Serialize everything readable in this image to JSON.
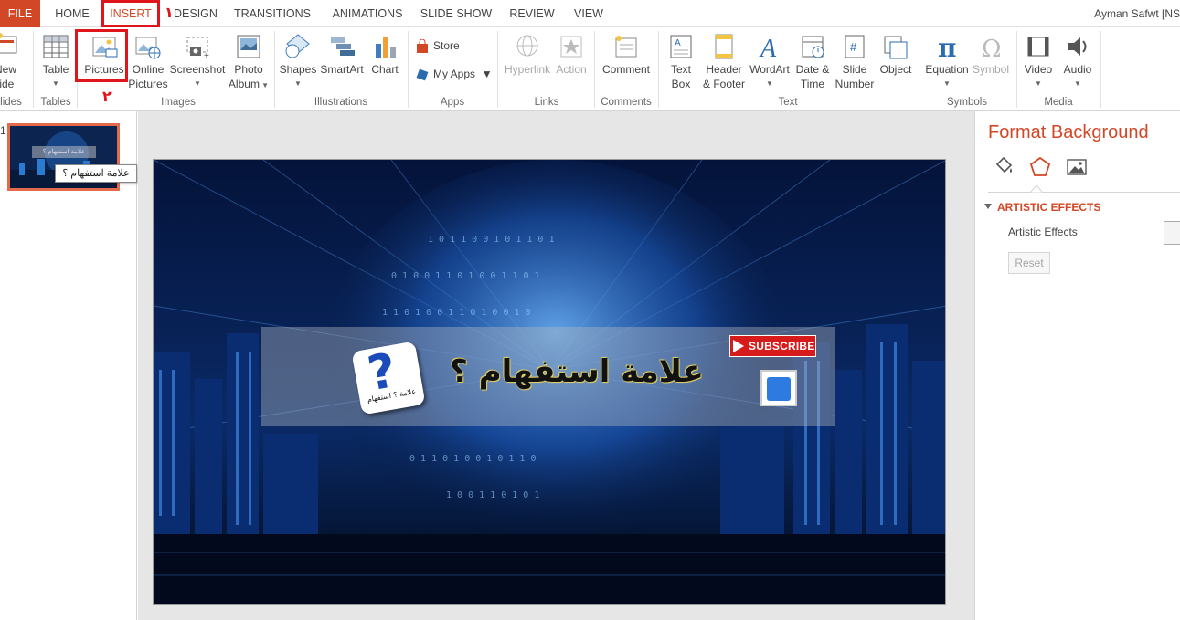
{
  "tabs": {
    "file": "FILE",
    "home": "HOME",
    "insert": "INSERT",
    "design": "DESIGN",
    "transitions": "TRANSITIONS",
    "animations": "ANIMATIONS",
    "slide_show": "SLIDE SHOW",
    "review": "REVIEW",
    "view": "VIEW"
  },
  "user": "Ayman Safwt [NS",
  "markers": {
    "one": "١",
    "two": "٢"
  },
  "ribbon": {
    "new_slide": [
      "New",
      "lide"
    ],
    "table": "Table",
    "pictures": "Pictures",
    "online_pictures": [
      "Online",
      "Pictures"
    ],
    "screenshot": "Screenshot",
    "photo_album": [
      "Photo",
      "Album"
    ],
    "shapes": "Shapes",
    "smartart": "SmartArt",
    "chart": "Chart",
    "store": "Store",
    "my_apps": "My Apps",
    "hyperlink": "Hyperlink",
    "action": "Action",
    "comment": "Comment",
    "text_box": [
      "Text",
      "Box"
    ],
    "header_footer": [
      "Header",
      "& Footer"
    ],
    "wordart": "WordArt",
    "date_time": [
      "Date &",
      "Time"
    ],
    "slide_number": [
      "Slide",
      "Number"
    ],
    "object": "Object",
    "equation": "Equation",
    "symbol": "Symbol",
    "video": "Video",
    "audio": "Audio"
  },
  "groups": {
    "slides": "lides",
    "tables": "Tables",
    "images": "Images",
    "illustrations": "Illustrations",
    "apps": "Apps",
    "links": "Links",
    "comments": "Comments",
    "text": "Text",
    "symbols": "Symbols",
    "media": "Media"
  },
  "thumbnails": {
    "number": "1",
    "tooltip": "علامة استفهام ؟",
    "mini_text": "علامة استفهام ؟"
  },
  "slide": {
    "title": "علامة استفهام ؟",
    "logo_text": "علامة ؟ استفهام",
    "subscribe": "SUBSCRIBE"
  },
  "format_pane": {
    "title": "Format Background",
    "section": "ARTISTIC EFFECTS",
    "artistic_label": "Artistic Effects",
    "reset": "Reset"
  },
  "colors": {
    "accent": "#d24726",
    "highlight": "#e0151c",
    "slide_bg": "#031030"
  }
}
